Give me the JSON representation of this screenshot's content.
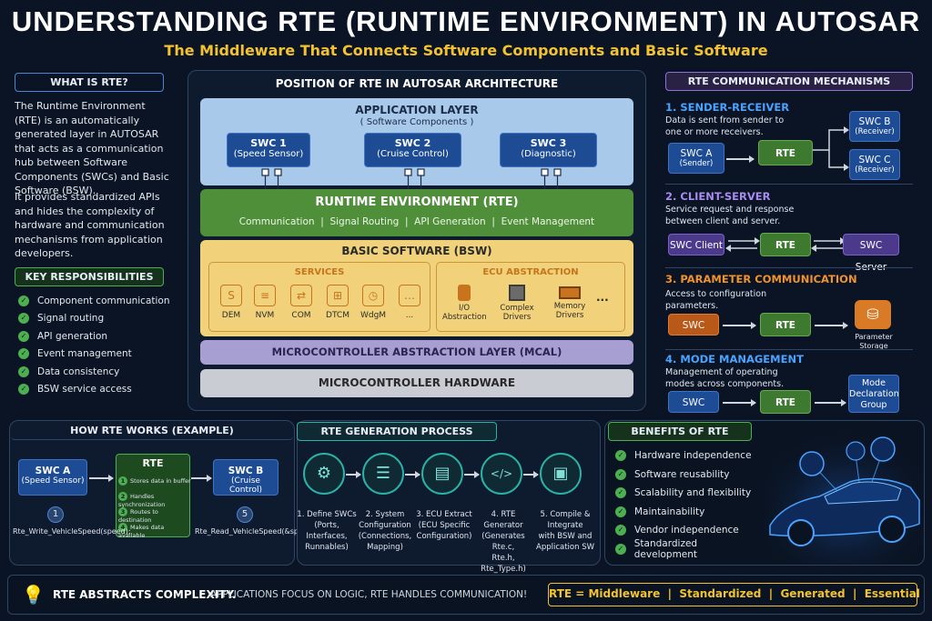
{
  "header": {
    "title": "UNDERSTANDING RTE (RUNTIME ENVIRONMENT) IN AUTOSAR",
    "subtitle": "The Middleware That Connects Software Components and Basic Software"
  },
  "what_is": {
    "heading": "WHAT IS RTE?",
    "p1": "The Runtime Environment (RTE) is an automatically generated layer in AUTOSAR that acts as a communication hub between Software Components (SWCs) and Basic Software (BSW).",
    "p2": "It provides standardized APIs and hides the complexity of hardware and communication mechanisms from application developers."
  },
  "responsibilities": {
    "heading": "KEY RESPONSIBILITIES",
    "items": [
      "Component communication",
      "Signal routing",
      "API generation",
      "Event management",
      "Data consistency",
      "BSW service access"
    ]
  },
  "architecture": {
    "heading": "POSITION OF RTE IN AUTOSAR ARCHITECTURE",
    "app_layer": "APPLICATION LAYER",
    "app_sub": "( Software Components )",
    "swcs": [
      {
        "name": "SWC 1",
        "desc": "(Speed Sensor)"
      },
      {
        "name": "SWC 2",
        "desc": "(Cruise Control)"
      },
      {
        "name": "SWC 3",
        "desc": "(Diagnostic)"
      }
    ],
    "rte_layer": "RUNTIME ENVIRONMENT (RTE)",
    "rte_features": "Communication  |  Signal Routing  |  API Generation  |  Event Management",
    "bsw_layer": "BASIC SOFTWARE (BSW)",
    "services_title": "SERVICES",
    "services": [
      {
        "label": "DEM",
        "icon": "S"
      },
      {
        "label": "NVM",
        "icon": "≡"
      },
      {
        "label": "COM",
        "icon": "⇄"
      },
      {
        "label": "DTCM",
        "icon": "⊞"
      },
      {
        "label": "WdgM",
        "icon": "◷"
      },
      {
        "label": "...",
        "icon": "…"
      }
    ],
    "ecu_title": "ECU ABSTRACTION",
    "ecu_items": [
      {
        "label": "I/O\nAbstraction"
      },
      {
        "label": "Complex\nDrivers"
      },
      {
        "label": "Memory\nDrivers"
      },
      {
        "label": "..."
      }
    ],
    "mcal": "MICROCONTROLLER ABSTRACTION LAYER (MCAL)",
    "hardware": "MICROCONTROLLER HARDWARE"
  },
  "mechanisms": {
    "heading": "RTE COMMUNICATION MECHANISMS",
    "sr": {
      "title": "1. SENDER-RECEIVER",
      "desc": "Data is sent from sender to one or more receivers.",
      "swc_a": "SWC A",
      "swc_a_sub": "(Sender)",
      "rte": "RTE",
      "swc_b": "SWC B",
      "swc_b_sub": "(Receiver)",
      "swc_c": "SWC C",
      "swc_c_sub": "(Receiver)"
    },
    "cs": {
      "title": "2. CLIENT-SERVER",
      "desc": "Service request and response between client and server.",
      "client": "SWC Client",
      "rte": "RTE",
      "server": "SWC Server"
    },
    "pc": {
      "title": "3. PARAMETER COMMUNICATION",
      "desc": "Access to configuration parameters.",
      "swc": "SWC",
      "rte": "RTE",
      "storage": "Parameter\nStorage"
    },
    "mm": {
      "title": "4. MODE MANAGEMENT",
      "desc": "Management of operating modes across components.",
      "swc": "SWC",
      "rte": "RTE",
      "group": "Mode\nDeclaration\nGroup"
    }
  },
  "how_works": {
    "heading": "HOW RTE WORKS (EXAMPLE)",
    "swc_a": "SWC A",
    "swc_a_sub": "(Speed Sensor)",
    "rte": "RTE",
    "steps": [
      "Stores data in buffer",
      "Handles synchronization",
      "Routes to destination",
      "Makes data available"
    ],
    "swc_b": "SWC B",
    "swc_b_sub": "(Cruise Control)",
    "step1": "1",
    "step5": "5",
    "api_write": "Rte_Write_VehicleSpeed(speed);",
    "api_read": "Rte_Read_VehicleSpeed(&speed);"
  },
  "generation": {
    "heading": "RTE GENERATION PROCESS",
    "steps": [
      {
        "icon": "⚙",
        "label": "1. Define SWCs\n(Ports, Interfaces,\nRunnables)"
      },
      {
        "icon": "☰",
        "label": "2. System\nConfiguration\n(Connections, Mapping)"
      },
      {
        "icon": "▤",
        "label": "3. ECU Extract\n(ECU Specific\nConfiguration)"
      },
      {
        "icon": "</>",
        "label": "4. RTE Generator\n(Generates Rte.c,\nRte.h, Rte_Type.h)"
      },
      {
        "icon": "▣",
        "label": "5. Compile & Integrate\nwith BSW and\nApplication SW"
      }
    ]
  },
  "benefits": {
    "heading": "BENEFITS OF RTE",
    "items": [
      "Hardware independence",
      "Software reusability",
      "Scalability and flexibility",
      "Maintainability",
      "Vendor independence",
      "Standardized development"
    ]
  },
  "footer": {
    "left_bold": "RTE ABSTRACTS COMPLEXITY.",
    "left_text": "APPLICATIONS FOCUS ON LOGIC, RTE HANDLES COMMUNICATION!",
    "right": "RTE = Middleware  |  Standardized  |  Generated  |  Essential"
  }
}
